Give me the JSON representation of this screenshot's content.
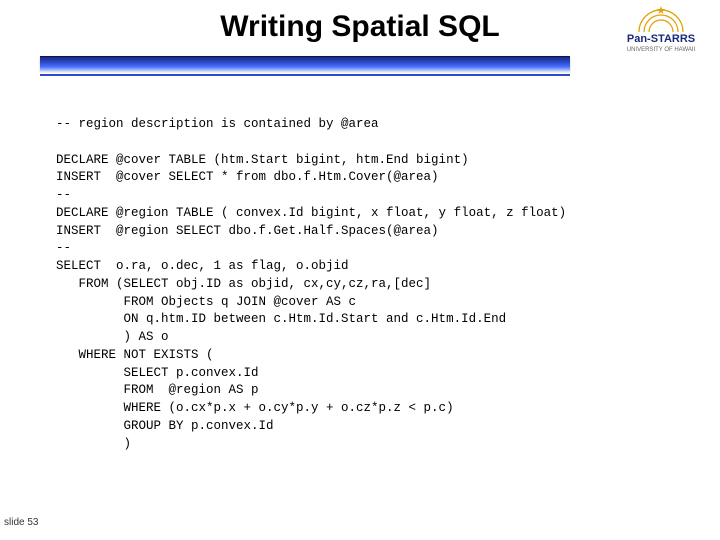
{
  "title": "Writing Spatial SQL",
  "logo": {
    "name": "Pan-STARRS",
    "sub": "UNIVERSITY OF HAWAII"
  },
  "code": {
    "l01": "-- region description is contained by @area",
    "l02": "",
    "l03": "DECLARE @cover TABLE (htm.Start bigint, htm.End bigint)",
    "l04": "INSERT  @cover SELECT * from dbo.f.Htm.Cover(@area)",
    "l05": "--",
    "l06": "DECLARE @region TABLE ( convex.Id bigint, x float, y float, z float)",
    "l07": "INSERT  @region SELECT dbo.f.Get.Half.Spaces(@area)",
    "l08": "--",
    "l09": "SELECT  o.ra, o.dec, 1 as flag, o.objid",
    "l10": "   FROM (SELECT obj.ID as objid, cx,cy,cz,ra,[dec]",
    "l11": "         FROM Objects q JOIN @cover AS c",
    "l12": "         ON q.htm.ID between c.Htm.Id.Start and c.Htm.Id.End",
    "l13": "         ) AS o",
    "l14": "   WHERE NOT EXISTS (",
    "l15": "         SELECT p.convex.Id",
    "l16": "         FROM  @region AS p",
    "l17": "         WHERE (o.cx*p.x + o.cy*p.y + o.cz*p.z < p.c)",
    "l18": "         GROUP BY p.convex.Id",
    "l19": "         )"
  },
  "slide_number": "slide 53"
}
